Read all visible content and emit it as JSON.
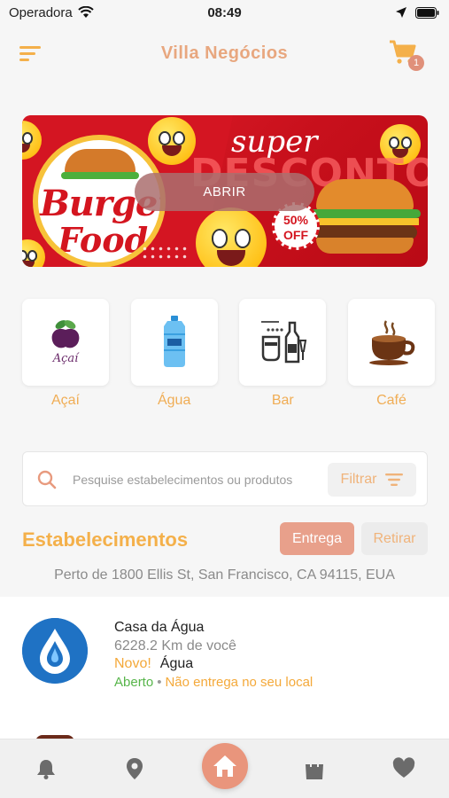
{
  "status_bar": {
    "carrier": "Operadora",
    "time": "08:49"
  },
  "header": {
    "title": "Villa Negócios",
    "cart_count": "1"
  },
  "banner": {
    "brand_line1": "Burger",
    "brand_line2": "Food",
    "headline_top": "super",
    "headline_bottom": "DESCONTO",
    "discount": "50%",
    "discount_suffix": "OFF",
    "button_label": "ABRIR"
  },
  "categories": [
    {
      "label": "Açaí",
      "icon": "acai-icon",
      "icon_text": "Açaí"
    },
    {
      "label": "Água",
      "icon": "water-gallon-icon"
    },
    {
      "label": "Bar",
      "icon": "bar-icon"
    },
    {
      "label": "Café",
      "icon": "coffee-cup-icon"
    }
  ],
  "search": {
    "placeholder": "Pesquise estabelecimentos ou produtos",
    "filter_label": "Filtrar"
  },
  "section": {
    "title": "Estabelecimentos",
    "delivery_label": "Entrega",
    "pickup_label": "Retirar",
    "address": "Perto de 1800 Ellis St, San Francisco, CA 94115, EUA"
  },
  "stores": [
    {
      "name": "Casa da Água",
      "distance": "6228.2 Km de você",
      "new_tag": "Novo!",
      "category": "Água",
      "status": "Aberto",
      "delivery_note": "Não entrega no seu local"
    }
  ],
  "colors": {
    "accent": "#e8a77f",
    "yellow": "#f4b04a",
    "open_green": "#57b54a",
    "home_button": "#e9957c"
  }
}
